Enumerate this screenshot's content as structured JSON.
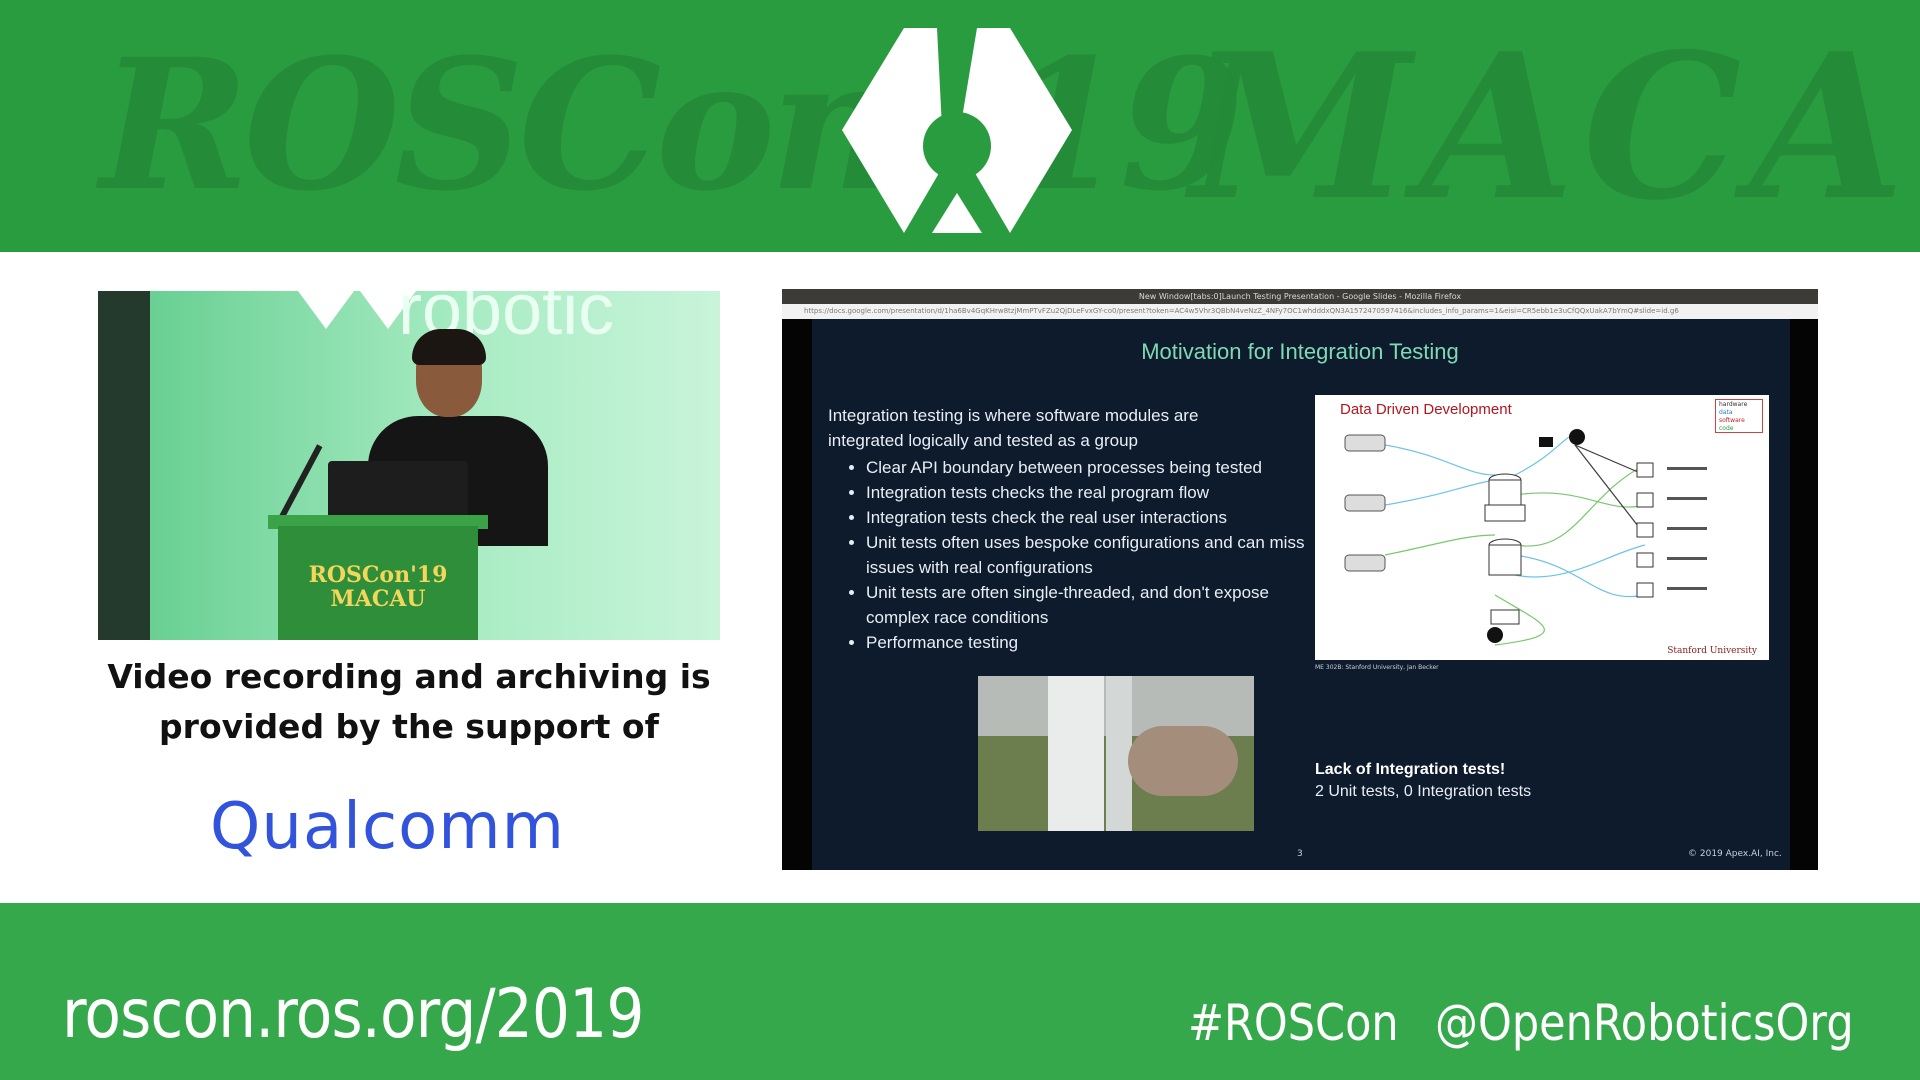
{
  "banner": {
    "bg_left": "ROSCon '19",
    "bg_right": "MACAU",
    "url": "roscon.ros.org/2019",
    "hashtag": "#ROSCon",
    "handle": "@OpenRoboticsOrg",
    "color": "#2a9c40"
  },
  "video": {
    "backdrop_sign": "robotic",
    "podium_text": "ROSCon'19\nMACAU"
  },
  "sponsor": {
    "line1": "Video recording and archiving is",
    "line2": "provided by the support of",
    "logo": "Qualcomm",
    "logo_color": "#3253dc"
  },
  "window": {
    "title": "New Window[tabs:0]Launch Testing Presentation - Google Slides - Mozilla Firefox",
    "url": "https://docs.google.com/presentation/d/1ha6Bv4GqKHrw8tzjMmPTvFZu2QjDLeFvxGY-co0/present?token=AC4w5Vhr3QBbN4veNzZ_4NFy7OC1whdddxQN3A1572470597416&includes_info_params=1&eisi=CR5ebb1e3uCfQQxUakA7bYmQ#slide=id.g6"
  },
  "slide": {
    "title": "Motivation for Integration Testing",
    "intro": "Integration testing is where software modules are integrated logically and tested as a group",
    "bullets": [
      "Clear API boundary between processes being tested",
      "Integration tests checks the real program flow",
      "Integration tests check the real user interactions",
      "Unit tests often uses bespoke configurations and can miss issues with real configurations",
      "Unit tests are often single-threaded, and don't expose complex race conditions",
      "Performance testing"
    ],
    "diagram_title": "Data Driven Development",
    "diagram_legend": [
      "hardware",
      "data",
      "software",
      "code"
    ],
    "diagram_credit": "Stanford University",
    "diagram_caption": "ME 302B: Stanford University, Jan Becker",
    "lack_title": "Lack of Integration tests!",
    "lack_sub": "2 Unit tests, 0 Integration tests",
    "page_number": "3",
    "copyright": "© 2019 Apex.AI, Inc.",
    "title_color": "#7fd9b3"
  }
}
